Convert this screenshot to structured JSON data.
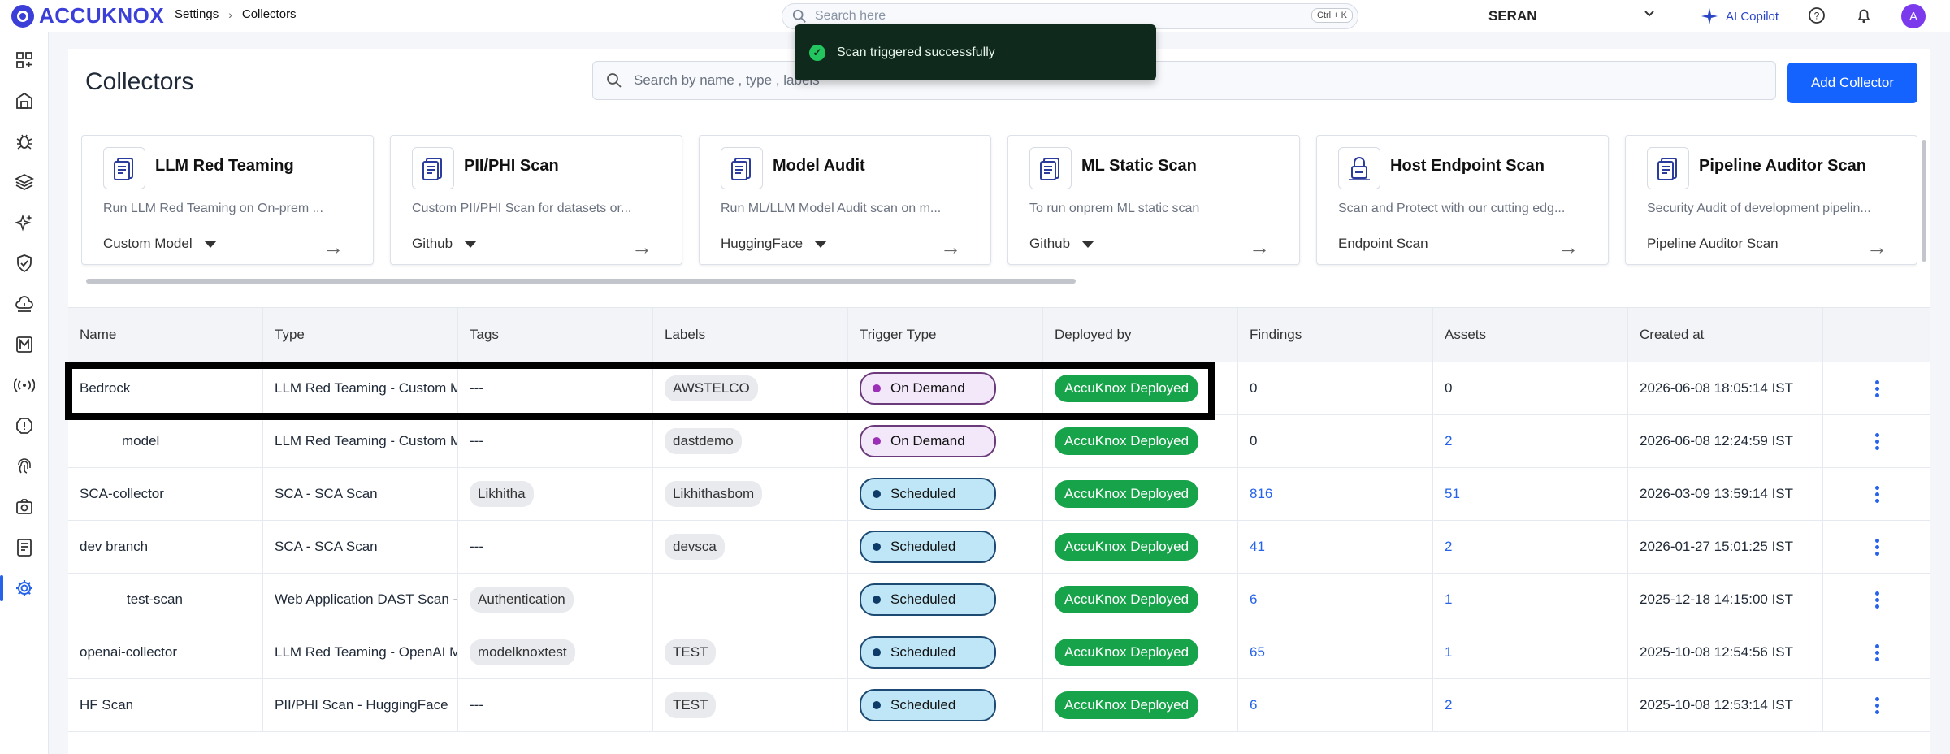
{
  "topbar": {
    "logo": "ACCUKNOX",
    "breadcrumb": [
      "Settings",
      "Collectors"
    ],
    "search_placeholder": "Search here",
    "shortcut": "Ctrl + K",
    "org": "SERAN",
    "copilot": "AI Copilot",
    "avatar_initial": "A"
  },
  "toast": {
    "message": "Scan triggered successfully"
  },
  "sidebar": {
    "icons": [
      "dashboard-icon",
      "inventory-icon",
      "bug-icon",
      "layers-icon",
      "sparkles-icon",
      "shield-check-icon",
      "cloud-alert-icon",
      "m-box-icon",
      "broadcast-icon",
      "warning-icon",
      "fingerprint-icon",
      "camera-icon",
      "report-icon",
      "settings-icon"
    ],
    "active": "settings-icon"
  },
  "page": {
    "title": "Collectors",
    "search_placeholder": "Search by name , type , labels",
    "add_button": "Add Collector"
  },
  "cards": [
    {
      "title": "LLM Red Teaming",
      "desc": "Run LLM Red Teaming on On-prem ...",
      "select": "Custom Model",
      "has_caret": true,
      "icon": "document-icon"
    },
    {
      "title": "PII/PHI Scan",
      "desc": "Custom PII/PHI Scan for datasets or...",
      "select": "Github",
      "has_caret": true,
      "icon": "document-icon"
    },
    {
      "title": "Model Audit",
      "desc": "Run ML/LLM Model Audit scan on m...",
      "select": "HuggingFace",
      "has_caret": true,
      "icon": "document-icon"
    },
    {
      "title": "ML Static Scan",
      "desc": "To run onprem ML static scan",
      "select": "Github",
      "has_caret": true,
      "icon": "document-icon"
    },
    {
      "title": "Host Endpoint Scan",
      "desc": "Scan and Protect with our cutting edg...",
      "select": "Endpoint Scan",
      "has_caret": false,
      "icon": "lock-icon"
    },
    {
      "title": "Pipeline Auditor Scan",
      "desc": "Security Audit of development pipelin...",
      "select": "Pipeline Auditor Scan",
      "has_caret": false,
      "icon": "document-icon"
    }
  ],
  "table": {
    "headers": [
      "Name",
      "Type",
      "Tags",
      "Labels",
      "Trigger Type",
      "Deployed by",
      "Findings",
      "Assets",
      "Created at",
      ""
    ],
    "rows": [
      {
        "name": "Bedrock",
        "type": "LLM Red Teaming - Custom Mo",
        "tags": "---",
        "label": "AWSTELCO",
        "trigger": "On Demand",
        "deployed": "AccuKnox Deployed",
        "findings": "0",
        "assets": "0",
        "created": "2026-06-08 18:05:14 IST"
      },
      {
        "name": "model",
        "type": "LLM Red Teaming - Custom Mo",
        "tags": "---",
        "label": "dastdemo",
        "trigger": "On Demand",
        "deployed": "AccuKnox Deployed",
        "findings": "0",
        "assets": "2",
        "created": "2026-06-08 12:24:59 IST"
      },
      {
        "name": "SCA-collector",
        "type": "SCA - SCA Scan",
        "tags": "Likhitha",
        "label": "Likhithasbom",
        "trigger": "Scheduled",
        "deployed": "AccuKnox Deployed",
        "findings": "816",
        "assets": "51",
        "created": "2026-03-09 13:59:14 IST"
      },
      {
        "name": "dev branch",
        "type": "SCA - SCA Scan",
        "tags": "---",
        "label": "devsca",
        "trigger": "Scheduled",
        "deployed": "AccuKnox Deployed",
        "findings": "41",
        "assets": "2",
        "created": "2026-01-27 15:01:25 IST"
      },
      {
        "name": "test-scan",
        "type": "Web Application DAST Scan -",
        "tags": "Authentication",
        "label": "",
        "trigger": "Scheduled",
        "deployed": "AccuKnox Deployed",
        "findings": "6",
        "assets": "1",
        "created": "2025-12-18 14:15:00 IST"
      },
      {
        "name": "openai-collector",
        "type": "LLM Red Teaming - OpenAI M",
        "tags": "modelknoxtest",
        "label": "TEST",
        "trigger": "Scheduled",
        "deployed": "AccuKnox Deployed",
        "findings": "65",
        "assets": "1",
        "created": "2025-10-08 12:54:56 IST"
      },
      {
        "name": "HF Scan",
        "type": "PII/PHI Scan - HuggingFace",
        "tags": "---",
        "label": "TEST",
        "trigger": "Scheduled",
        "deployed": "AccuKnox Deployed",
        "findings": "6",
        "assets": "2",
        "created": "2025-10-08 12:53:14 IST"
      }
    ]
  },
  "colors": {
    "accent": "#1463ff",
    "deployed": "#17a34a",
    "on_demand_dot": "#9b2fb5",
    "scheduled_dot": "#0d3a66"
  }
}
